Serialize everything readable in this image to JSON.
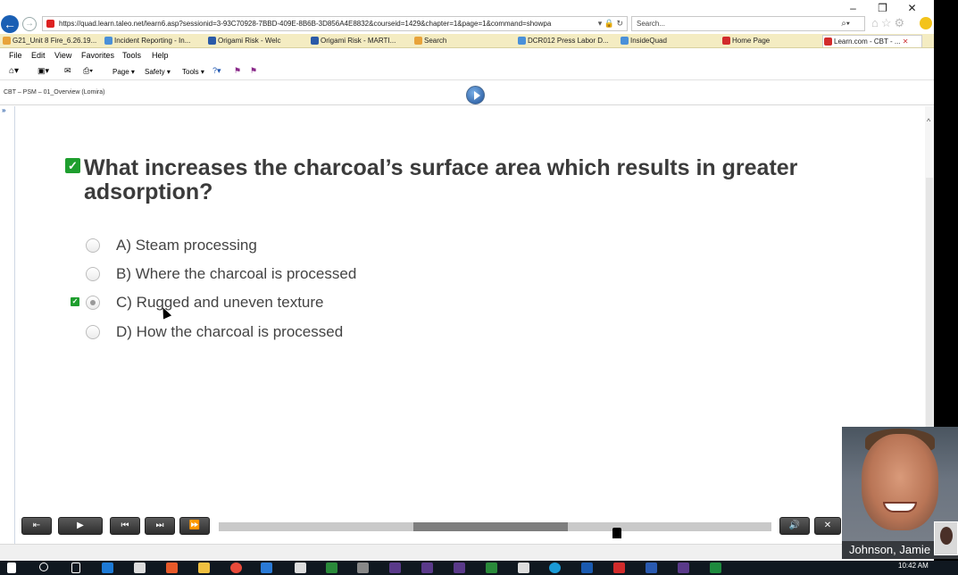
{
  "browser": {
    "url": "https://quad.learn.taleo.net/learn6.asp?sessionid=3-93C70928-7BBD-409E-8B6B-3D856A4E8832&courseid=1429&chapter=1&page=1&command=showpa",
    "search_placeholder": "Search...",
    "window_controls": [
      "–",
      "❐",
      "✕"
    ],
    "favorites": [
      {
        "label": "G21_Unit 8 Fire_6.26.19...",
        "color": "#e8a33a"
      },
      {
        "label": "Incident Reporting - In...",
        "color": "#4a90d9"
      },
      {
        "label": "Origami Risk - Welc",
        "color": "#2b5aa8"
      },
      {
        "label": "Origami Risk - MARTI...",
        "color": "#2b5aa8"
      },
      {
        "label": "Search",
        "color": "#e8a33a"
      },
      {
        "label": "DCR012 Press Labor D...",
        "color": "#4a90d9"
      },
      {
        "label": "InsideQuad",
        "color": "#4a90d9"
      },
      {
        "label": "Home Page",
        "color": "#d22b2b"
      },
      {
        "label": "Learn.com - CBT - ...",
        "color": "#d22b2b"
      }
    ],
    "menu": [
      "File",
      "Edit",
      "View",
      "Favorites",
      "Tools",
      "Help"
    ],
    "commands": [
      "Page ▾",
      "Safety ▾",
      "Tools ▾"
    ]
  },
  "course": {
    "title": "CBT – PSM – 01_Overview (Lomira)",
    "expand_label": "»"
  },
  "question": {
    "check_mark": "✓",
    "text": "What increases the charcoal’s surface area which results in greater adsorption?",
    "options": [
      {
        "label": "A) Steam processing",
        "selected": false
      },
      {
        "label": "B) Where the charcoal is processed",
        "selected": false
      },
      {
        "label": "C) Rugged and uneven texture",
        "selected": true
      },
      {
        "label": "D) How the charcoal is processed",
        "selected": false
      }
    ]
  },
  "player": {
    "buttons": [
      "⇤",
      "▶",
      "⏮",
      "⏭",
      "⏩"
    ],
    "volume": "🔊",
    "close": "✕",
    "progress_fraction": 0.72
  },
  "webcam": {
    "name": "Johnson, Jamie"
  },
  "taskbar": {
    "time": "10:42 AM"
  }
}
